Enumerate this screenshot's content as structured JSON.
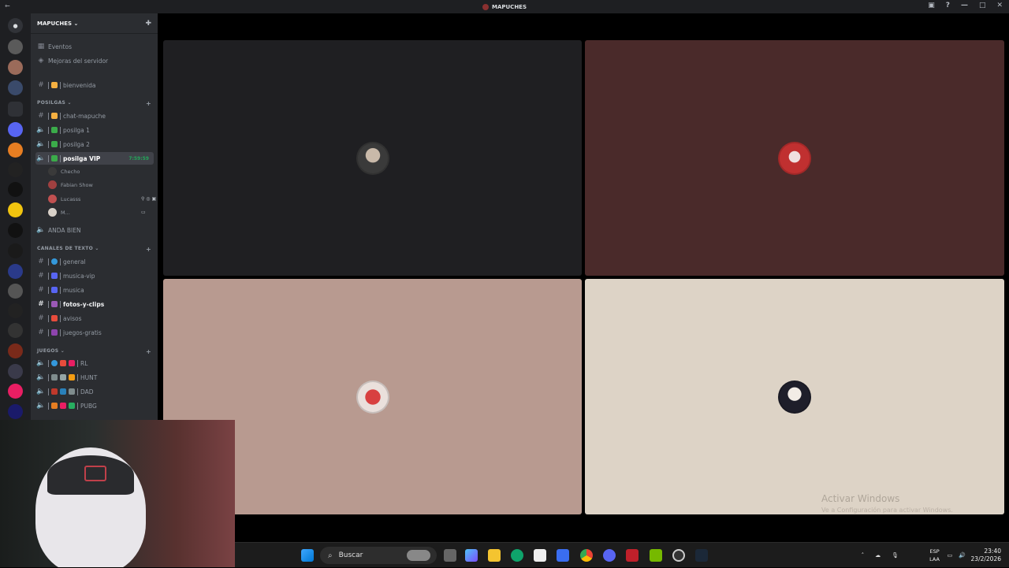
{
  "window": {
    "title": "MAPUCHES",
    "accent": "#5865f2"
  },
  "server": {
    "name": "MAPUCHES ⌄"
  },
  "top_items": [
    {
      "label": "Eventos",
      "icon": "calendar-icon"
    },
    {
      "label": "Mejoras del servidor",
      "icon": "boost-icon"
    }
  ],
  "welcome_channel": {
    "label": "bienvenida"
  },
  "categories": {
    "posilgas": "POSILGAS ⌄",
    "texto": "CANALES DE TEXTO ⌄",
    "juegos": "JUEGOS ⌄"
  },
  "posilgas_channels": [
    {
      "label": "chat-mapuche",
      "type": "text"
    },
    {
      "label": "posilga 1",
      "type": "voice"
    },
    {
      "label": "posilga 2",
      "type": "voice"
    },
    {
      "label": "posilga VIP",
      "type": "voice",
      "selected": true,
      "time": "7:59:59"
    }
  ],
  "voice_users": [
    {
      "name": "Checho"
    },
    {
      "name": "Fabian Show"
    },
    {
      "name": "Lucasss"
    },
    {
      "name": "M..."
    }
  ],
  "anda_bien": {
    "label": "ANDA BIEN"
  },
  "text_channels": [
    {
      "label": "general"
    },
    {
      "label": "musica-vip"
    },
    {
      "label": "musica"
    },
    {
      "label": "fotos-y-clips",
      "bold": true
    },
    {
      "label": "avisos"
    },
    {
      "label": "juegos-gratis"
    }
  ],
  "game_channels": [
    {
      "label": "RL"
    },
    {
      "label": "HUNT"
    },
    {
      "label": "DAD"
    },
    {
      "label": "PUBG"
    }
  ],
  "tiles": [
    {
      "name": "tile-checho",
      "color": "#1f1f22"
    },
    {
      "name": "tile-fabian",
      "color": "#4a2a2a"
    },
    {
      "name": "tile-lucasss",
      "color": "#b89a90"
    },
    {
      "name": "tile-m",
      "color": "#ddd3c6"
    }
  ],
  "watermark": {
    "title": "Activar Windows",
    "subtitle": "Ve a Configuración para activar Windows."
  },
  "taskbar": {
    "search_label": "Buscar",
    "lang_top": "ESP",
    "lang_bottom": "LAA",
    "time": "23:40",
    "date": "23/2/2026"
  }
}
